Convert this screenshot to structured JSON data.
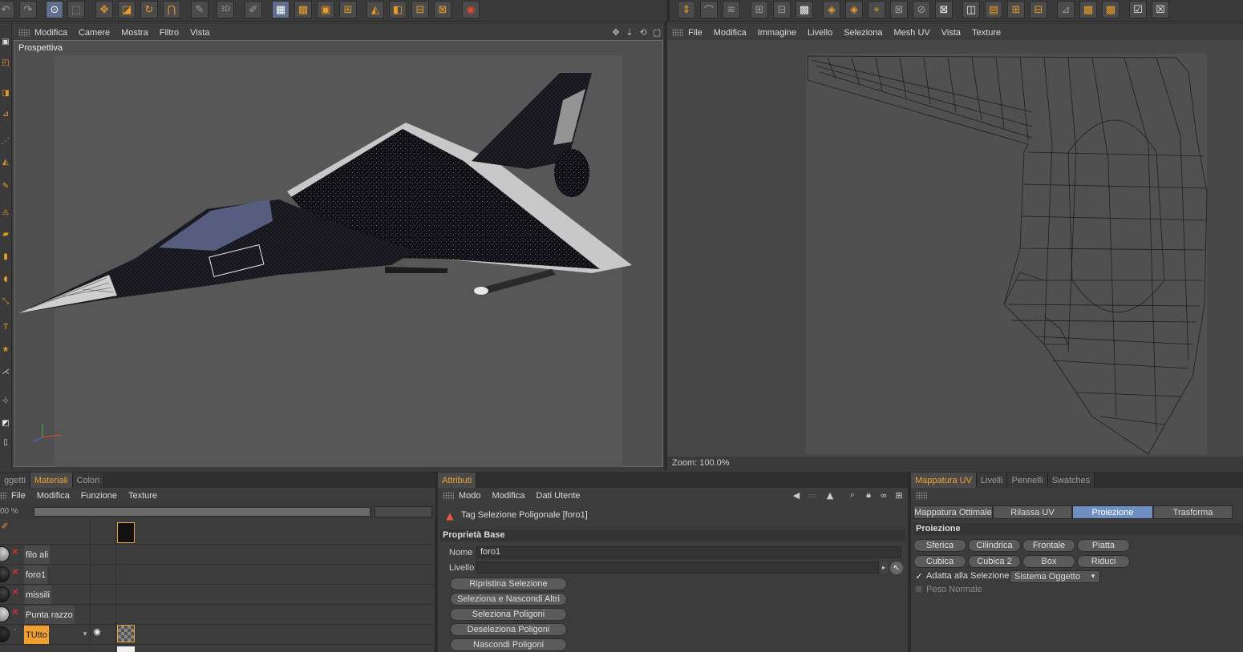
{
  "colors": {
    "accent": "#f0a030",
    "active_tab": "#6f8fc0",
    "viewport_bg": "#575757"
  },
  "left_view": {
    "menu": [
      "Modifica",
      "Camere",
      "Mostra",
      "Filtro",
      "Vista"
    ],
    "label": "Prospettiva",
    "nav_icons": [
      "move-icon",
      "down-arrow-icon",
      "rotate-icon",
      "maximize-icon"
    ]
  },
  "uv_view": {
    "menu": [
      "File",
      "Modifica",
      "Immagine",
      "Livello",
      "Seleziona",
      "Mesh UV",
      "Vista",
      "Texture"
    ],
    "zoom": "Zoom: 100.0%"
  },
  "materials": {
    "tabs": [
      "ggetti",
      "Materiali",
      "Colori"
    ],
    "menu": [
      "File",
      "Modifica",
      "Funzione",
      "Texture"
    ],
    "zoom_value": "00 %",
    "rows": [
      {
        "name": "filo ali"
      },
      {
        "name": "foro1"
      },
      {
        "name": "missili"
      },
      {
        "name": "Punta razzo"
      },
      {
        "name": "TUtto"
      }
    ]
  },
  "attributes": {
    "tab": "Attributi",
    "menu": [
      "Modo",
      "Modifica",
      "Dati Utente"
    ],
    "tag_title": "Tag Selezione Poligonale [foro1]",
    "section": "Proprietà Base",
    "name_label": "Nome",
    "name_value": "foro1",
    "level_label": "Livello",
    "buttons": [
      "Ripristina Selezione",
      "Seleziona e Nascondi Altri",
      "Seleziona Poligoni",
      "Deseleziona Poligoni",
      "Nascondi Poligoni"
    ]
  },
  "uv_mapping": {
    "tabs": [
      "Mappatura UV",
      "Livelli",
      "Pennelli",
      "Swatches"
    ],
    "subtabs": [
      "Mappatura Ottimale",
      "Rilassa UV",
      "Proiezione",
      "Trasforma"
    ],
    "section": "Proiezione",
    "buttons_row1": [
      "Sferica",
      "Cilindrica",
      "Frontale",
      "Piatta"
    ],
    "buttons_row2": [
      "Cubica",
      "Cubica 2",
      "Box",
      "Riduci"
    ],
    "adapt_label": "Adatta alla Selezione",
    "adapt_checked": true,
    "system_select": "Sistema Oggetto",
    "normal_weight_label": "Peso Normale",
    "normal_weight_checked": false
  }
}
